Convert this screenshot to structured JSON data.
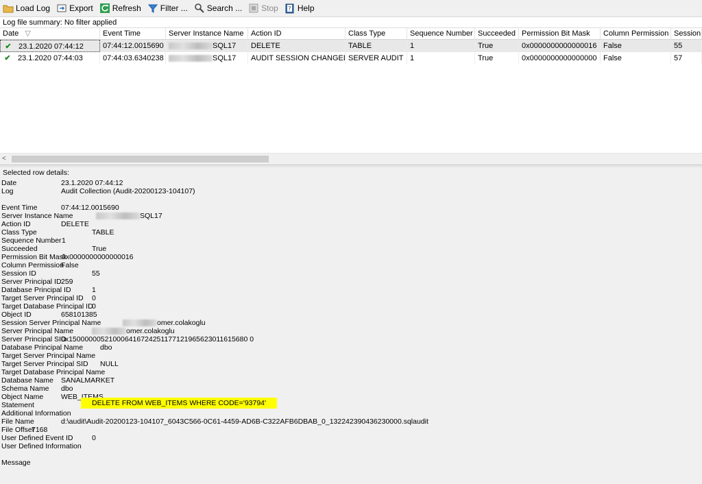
{
  "toolbar": {
    "load_log": "Load Log",
    "export": "Export",
    "refresh": "Refresh",
    "filter": "Filter ...",
    "search": "Search ...",
    "stop": "Stop",
    "help": "Help"
  },
  "summary": "Log file summary: No filter applied",
  "grid": {
    "headers": [
      "Date",
      "Event Time",
      "Server Instance Name",
      "Action ID",
      "Class Type",
      "Sequence Number",
      "Succeeded",
      "Permission Bit Mask",
      "Column Permission",
      "Session I"
    ],
    "rows": [
      [
        "23.1.2020 07:44:12",
        "07:44:12.0015690",
        "SQL17",
        "DELETE",
        "TABLE",
        "1",
        "True",
        "0x0000000000000016",
        "False",
        "55"
      ],
      [
        "23.1.2020 07:44:03",
        "07:44:03.6340238",
        "SQL17",
        "AUDIT SESSION CHANGED",
        "SERVER AUDIT",
        "1",
        "True",
        "0x0000000000000000",
        "False",
        "57"
      ]
    ]
  },
  "details": {
    "title": "Selected row details:",
    "date_label": "Date",
    "date_value": "23.1.2020 07:44:12",
    "log_label": "Log",
    "log_value": "Audit Collection (Audit-20200123-104107)",
    "event_time_label": "Event Time",
    "event_time_value": "07:44:12.0015690",
    "server_instance_label": "Server Instance Name",
    "server_instance_value": "SQL17",
    "action_id_label": "Action ID",
    "action_id_value": "DELETE",
    "class_type_label": "Class Type",
    "class_type_value": "TABLE",
    "sequence_label": "Sequence Number",
    "sequence_value": "1",
    "succeeded_label": "Succeeded",
    "succeeded_value": "True",
    "perm_mask_label": "Permission Bit Mask",
    "perm_mask_value": "0x0000000000000016",
    "column_perm_label": "Column Permission",
    "column_perm_value": "False",
    "session_id_label": "Session ID",
    "session_id_value": "55",
    "server_principal_id_label": "Server Principal ID",
    "server_principal_id_value": "259",
    "db_principal_id_label": "Database Principal ID",
    "db_principal_id_value": "1",
    "target_server_principal_id_label": "Target Server Principal ID",
    "target_server_principal_id_value": "0",
    "target_db_principal_id_label": "Target Database Principal ID",
    "target_db_principal_id_value": "0",
    "object_id_label": "Object ID",
    "object_id_value": "658101385",
    "session_server_principal_label": "Session Server Principal Name",
    "session_server_principal_value": "omer.colakoglu",
    "server_principal_name_label": "Server Principal Name",
    "server_principal_name_value": "omer.colakoglu",
    "server_principal_sid_label": "Server Principal SID",
    "server_principal_sid_value": "0x150000005210006416724251177121965623011615680 0",
    "db_principal_name_label": "Database Principal Name",
    "db_principal_name_value": "dbo",
    "target_server_principal_name_label": "Target Server Principal Name",
    "target_server_principal_sid_label": "Target Server Principal SID",
    "target_server_principal_sid_value": "NULL",
    "target_db_principal_name_label": "Target Database Principal Name",
    "db_name_label": "Database Name",
    "db_name_value": "SANALMARKET",
    "schema_name_label": "Schema Name",
    "schema_name_value": "dbo",
    "object_name_label": "Object Name",
    "object_name_value": "WEB_ITEMS",
    "statement_label": "Statement",
    "statement_value": "DELETE FROM WEB_ITEMS WHERE CODE='93794'",
    "additional_info_label": "Additional Information",
    "file_name_label": "File Name",
    "file_name_value": "d:\\audit\\Audit-20200123-104107_6043C566-0C61-4459-AD6B-C322AFB6DBAB_0_132242390436230000.sqlaudit",
    "file_offset_label": "File Offset",
    "file_offset_value": "7168",
    "user_event_id_label": "User Defined Event ID",
    "user_event_id_value": "0",
    "user_info_label": "User Defined Information",
    "message_label": "Message"
  }
}
